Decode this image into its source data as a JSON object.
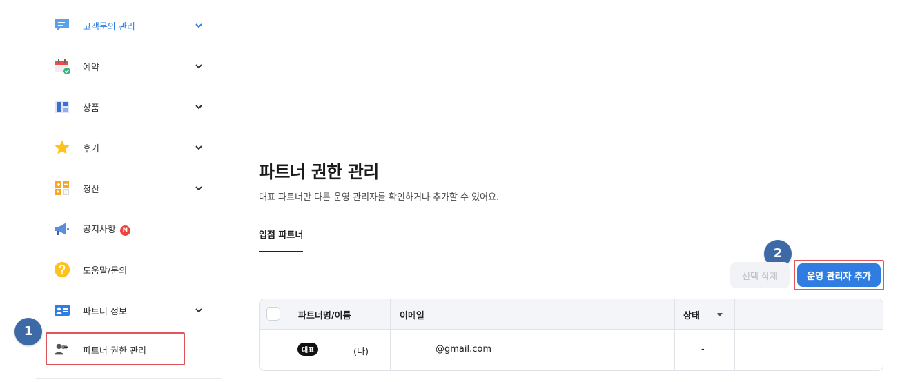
{
  "sidebar": {
    "items": [
      {
        "label": "고객문의 관리",
        "icon": "chat-bubble-icon",
        "expandable": true,
        "active": true
      },
      {
        "label": "예약",
        "icon": "calendar-check-icon",
        "expandable": true
      },
      {
        "label": "상품",
        "icon": "product-grid-icon",
        "expandable": true
      },
      {
        "label": "후기",
        "icon": "star-icon",
        "expandable": true
      },
      {
        "label": "정산",
        "icon": "calculator-icon",
        "expandable": true
      },
      {
        "label": "공지사항",
        "icon": "megaphone-icon",
        "badge": "N"
      },
      {
        "label": "도움말/문의",
        "icon": "help-question-icon"
      },
      {
        "label": "파트너 정보",
        "icon": "id-card-icon",
        "expandable": true
      },
      {
        "label": "파트너 권한 관리",
        "icon": "user-add-icon",
        "selected": true
      }
    ]
  },
  "annotations": {
    "step1": "1",
    "step2": "2"
  },
  "main": {
    "title": "파트너 권한 관리",
    "description": "대표 파트너만 다른 운영 관리자를 확인하거나 추가할 수 있어요.",
    "tab_label": "입점 파트너",
    "delete_button": "선택 삭제",
    "add_button": "운영 관리자 추가",
    "table": {
      "headers": {
        "name": "파트너명/이름",
        "email": "이메일",
        "status": "상태"
      },
      "rows": [
        {
          "badge": "대표",
          "name": "(나)",
          "email": "@gmail.com",
          "status": "-"
        }
      ]
    }
  },
  "colors": {
    "accent": "#2f7de1",
    "highlight_border": "#e0555b",
    "step_badge": "#3d6aa7",
    "notice_badge": "#f0443a"
  }
}
